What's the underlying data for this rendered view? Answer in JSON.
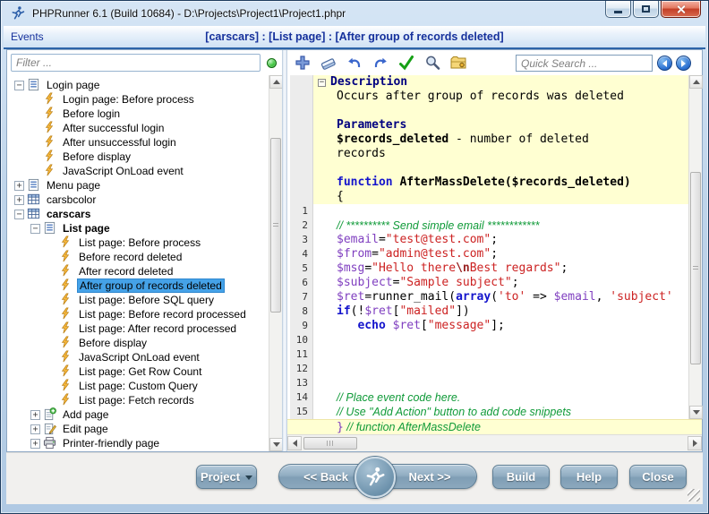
{
  "window": {
    "title": "PHPRunner 6.1 (Build 10684) - D:\\Projects\\Project1\\Project1.phpr",
    "controls": [
      "minimize",
      "maximize",
      "close"
    ]
  },
  "header": {
    "left": "Events",
    "breadcrumb": "[carscars] : [List page] : [After group of records deleted]"
  },
  "sidebar": {
    "filter_placeholder": "Filter ...",
    "tree": [
      {
        "level": 0,
        "expand": "-",
        "icon": "list-page",
        "label": "Login page"
      },
      {
        "level": 1,
        "icon": "event",
        "label": "Login page: Before process"
      },
      {
        "level": 1,
        "icon": "event",
        "label": "Before login"
      },
      {
        "level": 1,
        "icon": "event",
        "label": "After successful login"
      },
      {
        "level": 1,
        "icon": "event",
        "label": "After unsuccessful login"
      },
      {
        "level": 1,
        "icon": "event",
        "label": "Before display"
      },
      {
        "level": 1,
        "icon": "event",
        "label": "JavaScript OnLoad event"
      },
      {
        "level": 0,
        "expand": "+",
        "icon": "list-page",
        "label": "Menu page"
      },
      {
        "level": 0,
        "expand": "+",
        "icon": "table",
        "label": "carsbcolor"
      },
      {
        "level": 0,
        "expand": "-",
        "icon": "table",
        "label": "carscars",
        "bold": true
      },
      {
        "level": 1,
        "expand": "-",
        "icon": "list-page",
        "label": "List page",
        "bold": true
      },
      {
        "level": 2,
        "icon": "event",
        "label": "List page: Before process"
      },
      {
        "level": 2,
        "icon": "event",
        "label": "Before record deleted"
      },
      {
        "level": 2,
        "icon": "event",
        "label": "After record deleted"
      },
      {
        "level": 2,
        "icon": "event",
        "label": "After group of records deleted",
        "selected": true
      },
      {
        "level": 2,
        "icon": "event",
        "label": "List page: Before SQL query"
      },
      {
        "level": 2,
        "icon": "event",
        "label": "List page: Before record processed"
      },
      {
        "level": 2,
        "icon": "event",
        "label": "List page: After record processed"
      },
      {
        "level": 2,
        "icon": "event",
        "label": "Before display"
      },
      {
        "level": 2,
        "icon": "event",
        "label": "JavaScript OnLoad event"
      },
      {
        "level": 2,
        "icon": "event",
        "label": "List page: Get Row Count"
      },
      {
        "level": 2,
        "icon": "event",
        "label": "List page: Custom Query"
      },
      {
        "level": 2,
        "icon": "event",
        "label": "List page: Fetch records"
      },
      {
        "level": 1,
        "expand": "+",
        "icon": "add-page",
        "label": "Add page"
      },
      {
        "level": 1,
        "expand": "+",
        "icon": "edit-page",
        "label": "Edit page"
      },
      {
        "level": 1,
        "expand": "+",
        "icon": "printer",
        "label": "Printer-friendly page"
      }
    ]
  },
  "toolbar": {
    "icons": [
      "add-action",
      "eraser",
      "undo",
      "redo",
      "check-syntax",
      "find",
      "snippets"
    ],
    "quick_search_placeholder": "Quick Search ..."
  },
  "editor": {
    "description": [
      {
        "collapser": true,
        "segs": [
          [
            "h",
            "Description"
          ]
        ]
      },
      {
        "segs": [
          [
            "p",
            "Occurs after group of records was deleted"
          ]
        ]
      },
      {
        "segs": []
      },
      {
        "segs": [
          [
            "h",
            "Parameters"
          ]
        ]
      },
      {
        "segs": [
          [
            "b",
            "$records_deleted"
          ],
          [
            "p",
            " - number of deleted"
          ]
        ]
      },
      {
        "segs": [
          [
            "p",
            "records"
          ]
        ]
      },
      {
        "segs": []
      },
      {
        "segs": [
          [
            "k",
            "function"
          ],
          [
            "b",
            " AfterMassDelete($records_deleted)"
          ]
        ]
      },
      {
        "segs": [
          [
            "p",
            "{"
          ]
        ]
      }
    ],
    "code": [
      {
        "n": "1",
        "segs": []
      },
      {
        "n": "2",
        "segs": [
          [
            "c",
            "// ********** Send simple email ************"
          ]
        ]
      },
      {
        "n": "3",
        "segs": [
          [
            "v",
            "$email"
          ],
          [
            "p",
            "="
          ],
          [
            "s",
            "\"test@test.com\""
          ],
          [
            "p",
            ";"
          ]
        ]
      },
      {
        "n": "4",
        "segs": [
          [
            "v",
            "$from"
          ],
          [
            "p",
            "="
          ],
          [
            "s",
            "\"admin@test.com\""
          ],
          [
            "p",
            ";"
          ]
        ]
      },
      {
        "n": "5",
        "segs": [
          [
            "v",
            "$msg"
          ],
          [
            "p",
            "="
          ],
          [
            "s",
            "\"Hello there"
          ],
          [
            "e",
            "\\n"
          ],
          [
            "s",
            "Best regards\""
          ],
          [
            "p",
            ";"
          ]
        ]
      },
      {
        "n": "6",
        "segs": [
          [
            "v",
            "$subject"
          ],
          [
            "p",
            "="
          ],
          [
            "s",
            "\"Sample subject\""
          ],
          [
            "p",
            ";"
          ]
        ]
      },
      {
        "n": "7",
        "segs": [
          [
            "v",
            "$ret"
          ],
          [
            "p",
            "=runner_mail("
          ],
          [
            "k",
            "array"
          ],
          [
            "p",
            "("
          ],
          [
            "s",
            "'to'"
          ],
          [
            "p",
            " => "
          ],
          [
            "v",
            "$email"
          ],
          [
            "p",
            ", "
          ],
          [
            "s",
            "'subject'"
          ]
        ]
      },
      {
        "n": "8",
        "segs": [
          [
            "k",
            "if"
          ],
          [
            "p",
            "(!"
          ],
          [
            "v",
            "$ret"
          ],
          [
            "p",
            "["
          ],
          [
            "s",
            "\"mailed\""
          ],
          [
            "p",
            "])"
          ]
        ]
      },
      {
        "n": "9",
        "segs": [
          [
            "p",
            "   "
          ],
          [
            "k",
            "echo"
          ],
          [
            "p",
            " "
          ],
          [
            "v",
            "$ret"
          ],
          [
            "p",
            "["
          ],
          [
            "s",
            "\"message\""
          ],
          [
            "p",
            "];"
          ]
        ]
      },
      {
        "n": "10",
        "segs": []
      },
      {
        "n": "11",
        "segs": []
      },
      {
        "n": "12",
        "segs": []
      },
      {
        "n": "13",
        "segs": []
      },
      {
        "n": "14",
        "segs": [
          [
            "c",
            "// Place event code here."
          ]
        ]
      },
      {
        "n": "15",
        "segs": [
          [
            "c",
            "// Use \"Add Action\" button to add code snippets"
          ]
        ]
      }
    ],
    "footer": [
      [
        "v",
        "}"
      ],
      [
        "c",
        " // function AfterMassDelete"
      ]
    ]
  },
  "footerbar": {
    "project": "Project",
    "back": "<< Back",
    "next": "Next >>",
    "build": "Build",
    "help": "Help",
    "close": "Close"
  },
  "colors": {
    "selection": "#45a2e8",
    "keyword": "#1414cc",
    "string": "#cc2222",
    "variable": "#8040c0",
    "comment": "#0f9a38",
    "description_bg": "#ffffd2",
    "header_text": "#16319c"
  }
}
